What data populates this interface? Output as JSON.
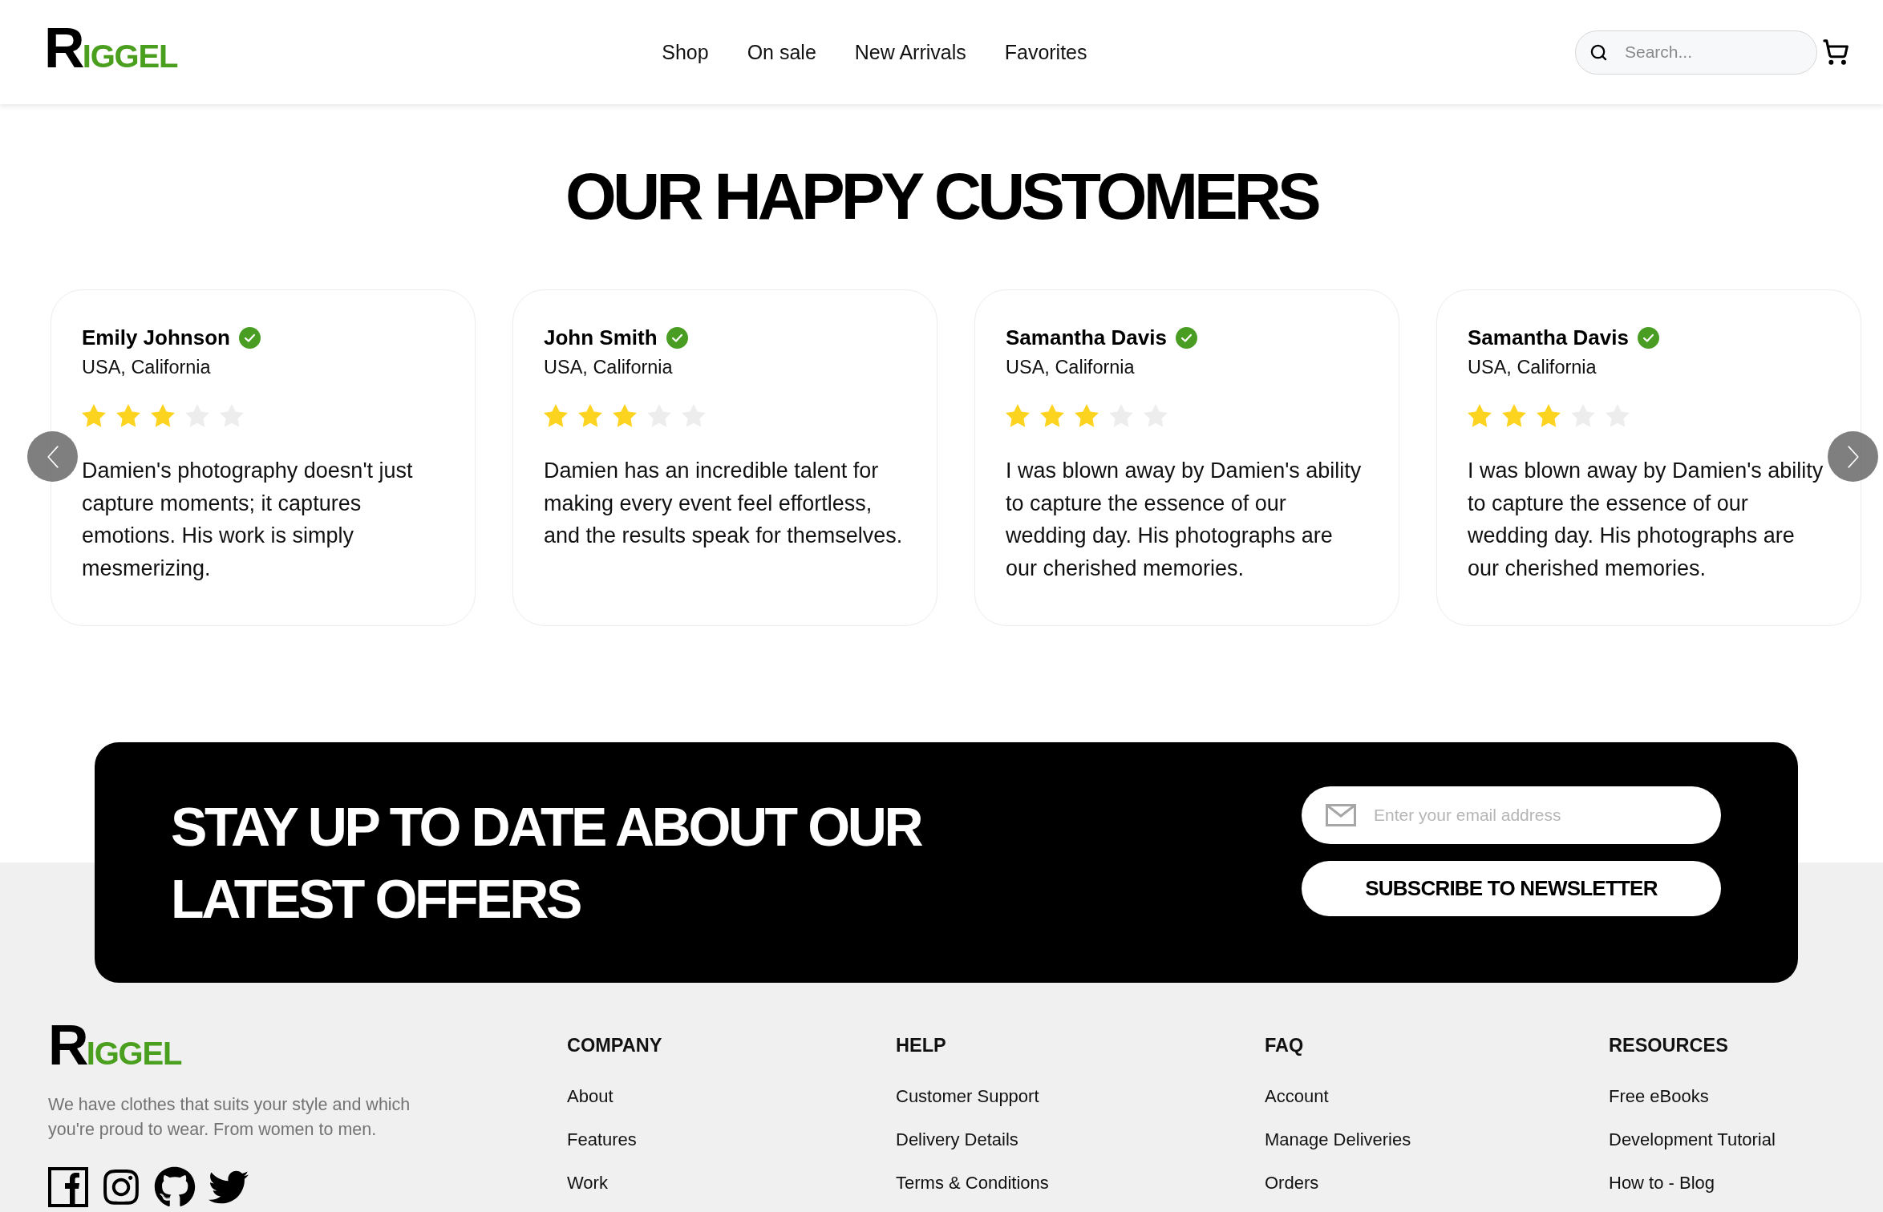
{
  "header": {
    "logo": "RIGGEL",
    "nav": [
      "Shop",
      "On sale",
      "New Arrivals",
      "Favorites"
    ],
    "search": {
      "placeholder": "Search..."
    }
  },
  "testimonials": {
    "title": "OUR HAPPY CUSTOMERS",
    "reviews": [
      {
        "name": "Emily Johnson",
        "verified": true,
        "location": "USA, California",
        "stars": 3,
        "text": "Damien's photography doesn't just capture moments; it captures emotions. His work is simply mesmerizing."
      },
      {
        "name": "John Smith",
        "verified": true,
        "location": "USA, California",
        "stars": 3,
        "text": "Damien has an incredible talent for making every event feel effortless, and the results speak for themselves."
      },
      {
        "name": "Samantha Davis",
        "verified": true,
        "location": "USA, California",
        "stars": 3,
        "text": "I was blown away by Damien's ability to capture the essence of our wedding day. His photographs are our cherished memories."
      },
      {
        "name": "Samantha Davis",
        "verified": true,
        "location": "USA, California",
        "stars": 3,
        "text": "I was blown away by Damien's ability to capture the essence of our wedding day. His photographs are our cherished memories."
      }
    ]
  },
  "newsletter": {
    "title": "STAY UP TO DATE ABOUT OUR LATEST OFFERS",
    "email": {
      "placeholder": "Enter your email address"
    },
    "button": "SUBSCRIBE TO NEWSLETTER"
  },
  "footer": {
    "logo": "RIGGEL",
    "description": "We have clothes that suits your style and which you're proud to wear. From women to men.",
    "columns": [
      {
        "heading": "COMPANY",
        "links": [
          "About",
          "Features",
          "Work"
        ]
      },
      {
        "heading": "HELP",
        "links": [
          "Customer Support",
          "Delivery Details",
          "Terms & Conditions"
        ]
      },
      {
        "heading": "FAQ",
        "links": [
          "Account",
          "Manage Deliveries",
          "Orders"
        ]
      },
      {
        "heading": "RESOURCES",
        "links": [
          "Free eBooks",
          "Development Tutorial",
          "How to - Blog"
        ]
      }
    ]
  }
}
